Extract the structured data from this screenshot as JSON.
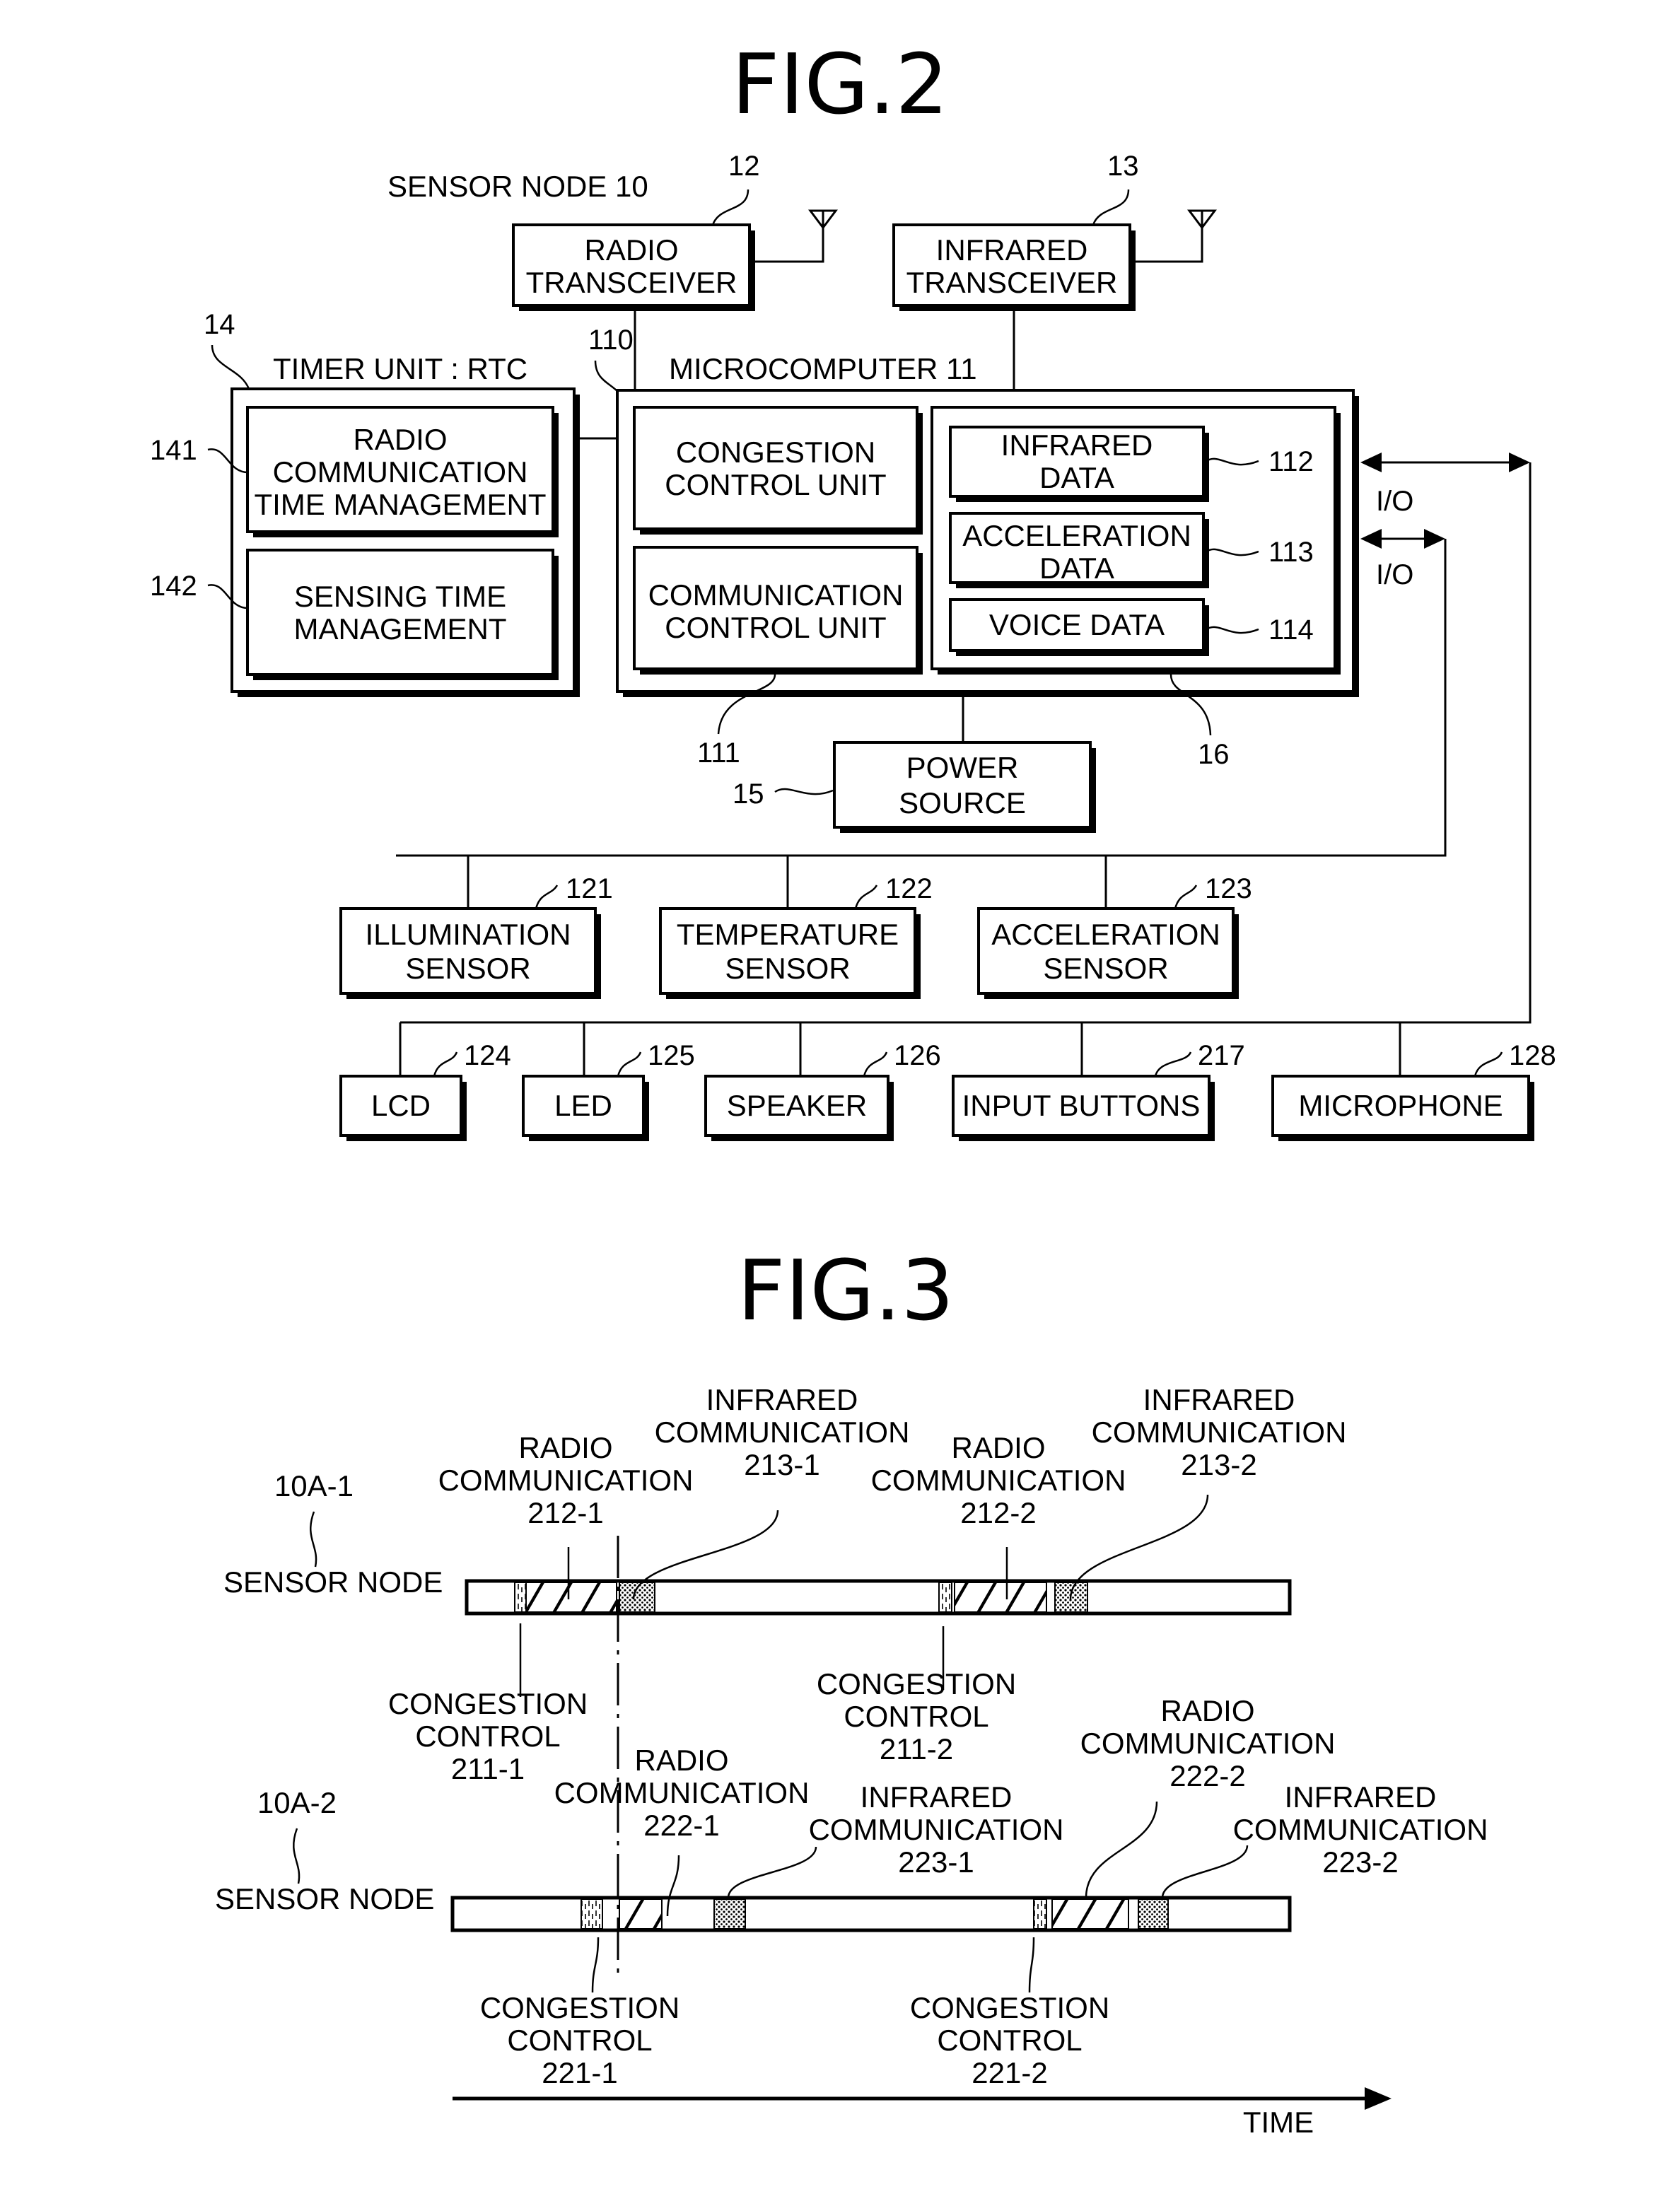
{
  "fig2": {
    "title": "FIG.2",
    "sensor_node_label": "SENSOR NODE 10",
    "radio_transceiver": {
      "lines": [
        "RADIO",
        "TRANSCEIVER"
      ],
      "ref": "12"
    },
    "infrared_transceiver": {
      "lines": [
        "INFRARED",
        "TRANSCEIVER"
      ],
      "ref": "13"
    },
    "timer_unit": {
      "label": "TIMER UNIT : RTC",
      "ref": "14",
      "blocks": [
        {
          "lines": [
            "RADIO",
            "COMMUNICATION",
            "TIME MANAGEMENT"
          ],
          "ref": "141"
        },
        {
          "lines": [
            "SENSING TIME",
            "MANAGEMENT"
          ],
          "ref": "142"
        }
      ]
    },
    "microcomputer": {
      "label": "MICROCOMPUTER 11",
      "congestion_control": {
        "lines": [
          "CONGESTION",
          "CONTROL UNIT"
        ],
        "ref": "110"
      },
      "communication_control": {
        "lines": [
          "COMMUNICATION",
          "CONTROL UNIT"
        ],
        "ref": "111"
      },
      "memory": {
        "ref": "16",
        "items": [
          {
            "lines": [
              "INFRARED",
              "DATA"
            ],
            "ref": "112"
          },
          {
            "lines": [
              "ACCELERATION",
              "DATA"
            ],
            "ref": "113"
          },
          {
            "lines": [
              "VOICE DATA"
            ],
            "ref": "114"
          }
        ]
      }
    },
    "io_labels": [
      "I/O",
      "I/O"
    ],
    "power_source": {
      "lines": [
        "POWER",
        "SOURCE"
      ],
      "ref": "15"
    },
    "sensors": [
      {
        "lines": [
          "ILLUMINATION",
          "SENSOR"
        ],
        "ref": "121"
      },
      {
        "lines": [
          "TEMPERATURE",
          "SENSOR"
        ],
        "ref": "122"
      },
      {
        "lines": [
          "ACCELERATION",
          "SENSOR"
        ],
        "ref": "123"
      }
    ],
    "devices": [
      {
        "label": "LCD",
        "ref": "124"
      },
      {
        "label": "LED",
        "ref": "125"
      },
      {
        "label": "SPEAKER",
        "ref": "126"
      },
      {
        "label": "INPUT BUTTONS",
        "ref": "217"
      },
      {
        "label": "MICROPHONE",
        "ref": "128"
      }
    ]
  },
  "fig3": {
    "title": "FIG.3",
    "time_label": "TIME",
    "nodes": [
      {
        "id": "10A-1",
        "label": "SENSOR NODE",
        "events": [
          {
            "kind": "congestion",
            "lines": [
              "CONGESTION",
              "CONTROL",
              "211-1"
            ]
          },
          {
            "kind": "radio",
            "lines": [
              "RADIO",
              "COMMUNICATION",
              "212-1"
            ]
          },
          {
            "kind": "infrared",
            "lines": [
              "INFRARED",
              "COMMUNICATION",
              "213-1"
            ]
          },
          {
            "kind": "congestion",
            "lines": [
              "CONGESTION",
              "CONTROL",
              "211-2"
            ]
          },
          {
            "kind": "radio",
            "lines": [
              "RADIO",
              "COMMUNICATION",
              "212-2"
            ]
          },
          {
            "kind": "infrared",
            "lines": [
              "INFRARED",
              "COMMUNICATION",
              "213-2"
            ]
          }
        ]
      },
      {
        "id": "10A-2",
        "label": "SENSOR NODE",
        "events": [
          {
            "kind": "congestion",
            "lines": [
              "CONGESTION",
              "CONTROL",
              "221-1"
            ]
          },
          {
            "kind": "radio",
            "lines": [
              "RADIO",
              "COMMUNICATION",
              "222-1"
            ]
          },
          {
            "kind": "infrared",
            "lines": [
              "INFRARED",
              "COMMUNICATION",
              "223-1"
            ]
          },
          {
            "kind": "congestion",
            "lines": [
              "CONGESTION",
              "CONTROL",
              "221-2"
            ]
          },
          {
            "kind": "radio",
            "lines": [
              "RADIO",
              "COMMUNICATION",
              "222-2"
            ]
          },
          {
            "kind": "infrared",
            "lines": [
              "INFRARED",
              "COMMUNICATION",
              "223-2"
            ]
          }
        ]
      }
    ]
  }
}
